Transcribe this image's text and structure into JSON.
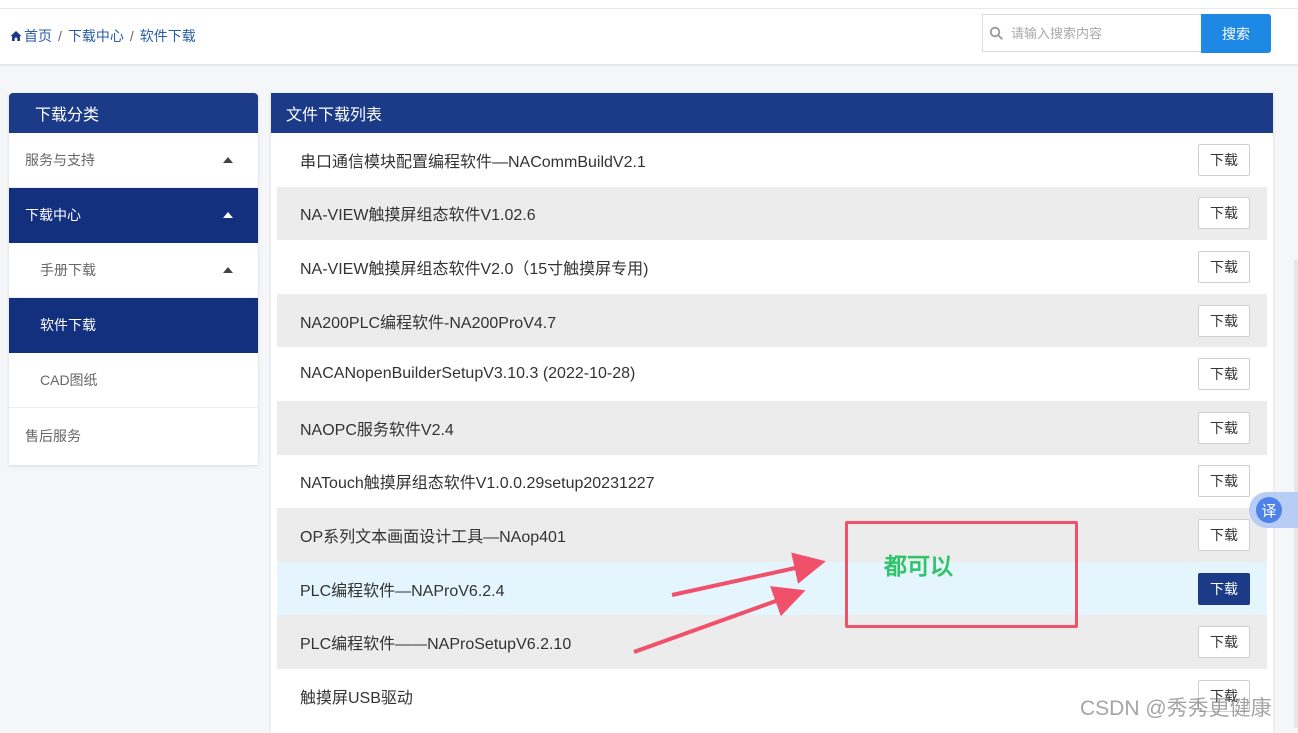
{
  "breadcrumb": {
    "home": "首页",
    "sep": "/",
    "items": [
      "下载中心",
      "软件下载"
    ]
  },
  "search": {
    "placeholder": "请输入搜索内容",
    "button": "搜索"
  },
  "sidebar": {
    "title": "下载分类",
    "items": [
      {
        "label": "服务与支持",
        "expanded": true,
        "active": false,
        "sub": false
      },
      {
        "label": "下载中心",
        "expanded": true,
        "active": true,
        "sub": false
      },
      {
        "label": "手册下载",
        "expanded": true,
        "active": false,
        "sub": true
      },
      {
        "label": "软件下载",
        "active": true,
        "sub": true
      },
      {
        "label": "CAD图纸",
        "active": false,
        "sub": true
      },
      {
        "label": "售后服务",
        "active": false,
        "sub": false
      }
    ]
  },
  "panel": {
    "title": "文件下载列表",
    "download_label": "下载",
    "files": [
      "串口通信模块配置编程软件—NACommBuildV2.1",
      "NA-VIEW触摸屏组态软件V1.02.6",
      "NA-VIEW触摸屏组态软件V2.0（15寸触摸屏专用)",
      "NA200PLC编程软件-NA200ProV4.7",
      "NACANopenBuilderSetupV3.10.3 (2022-10-28)",
      "NAOPC服务软件V2.4",
      "NATouch触摸屏组态软件V1.0.0.29setup20231227",
      "OP系列文本画面设计工具—NAop401",
      "PLC编程软件—NAProV6.2.4",
      "PLC编程软件——NAProSetupV6.2.10",
      "触摸屏USB驱动"
    ]
  },
  "annotation": {
    "text": "都可以"
  },
  "translate_tab": "译",
  "watermark": "CSDN @秀秀更健康",
  "colors": {
    "nav_dark": "#1b3a87",
    "accent": "#1e88e5",
    "annotation": "#f0506a",
    "annotation_text": "#2fc36a"
  }
}
